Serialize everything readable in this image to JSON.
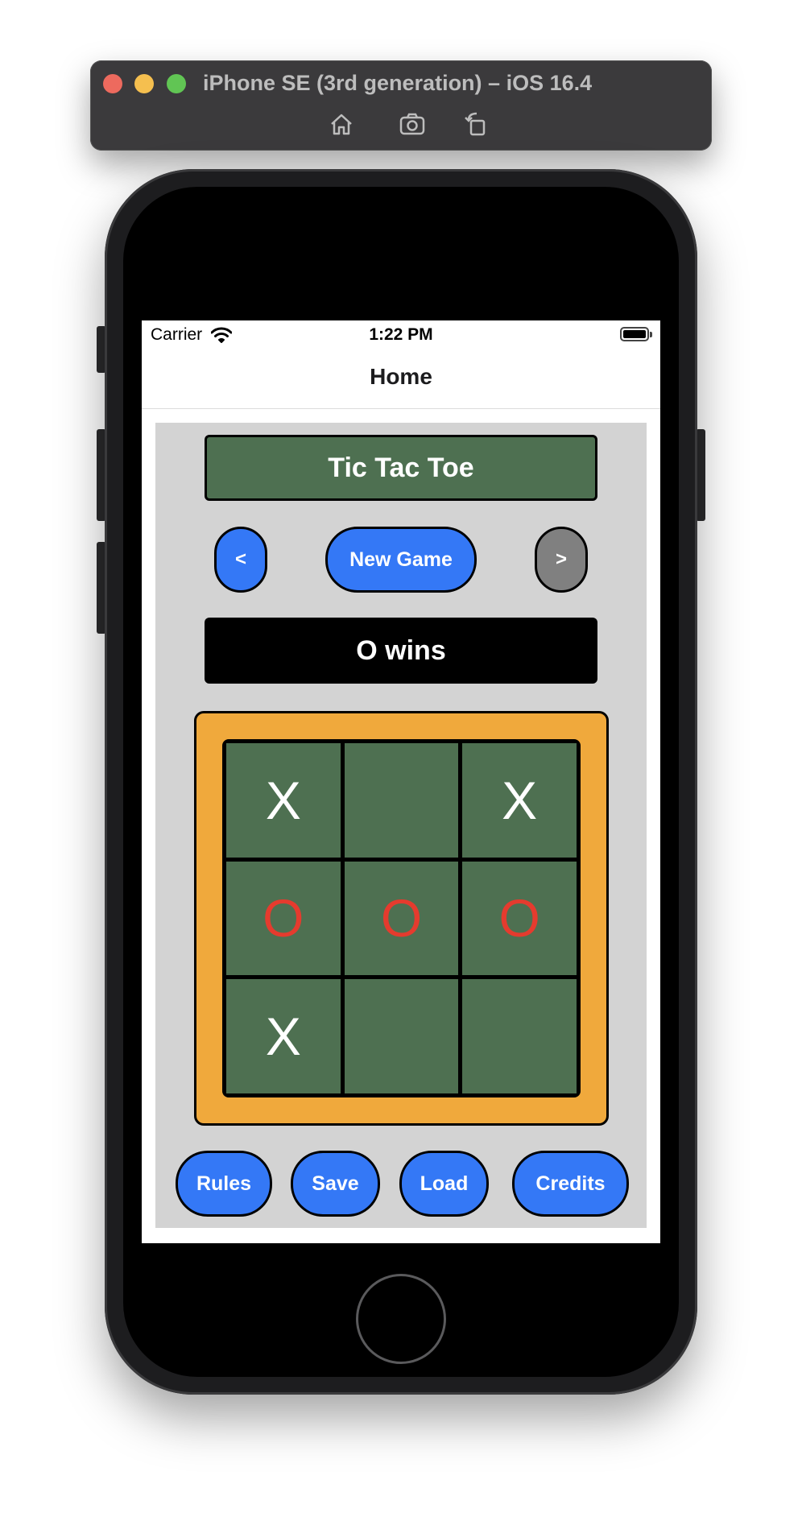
{
  "simulator": {
    "title": "iPhone SE (3rd generation) – iOS 16.4",
    "tools": [
      "home-icon",
      "screenshot-icon",
      "rotate-icon"
    ]
  },
  "status_bar": {
    "carrier": "Carrier",
    "time": "1:22 PM",
    "icons": [
      "wifi-icon",
      "battery-icon"
    ]
  },
  "nav": {
    "title": "Home"
  },
  "game": {
    "title": "Tic Tac Toe",
    "prev_label": "<",
    "new_game_label": "New Game",
    "next_label": ">",
    "status": "O wins",
    "board": [
      "X",
      "",
      "X",
      "O",
      "O",
      "O",
      "X",
      "",
      ""
    ]
  },
  "footer_buttons": {
    "rules": "Rules",
    "save": "Save",
    "load": "Load",
    "credits": "Credits"
  },
  "colors": {
    "board_green": "#4e7051",
    "frame_orange": "#f0a93c",
    "button_blue": "#3478f6",
    "button_gray": "#808080",
    "o_red": "#e53b2e",
    "panel_gray": "#d3d3d3"
  }
}
